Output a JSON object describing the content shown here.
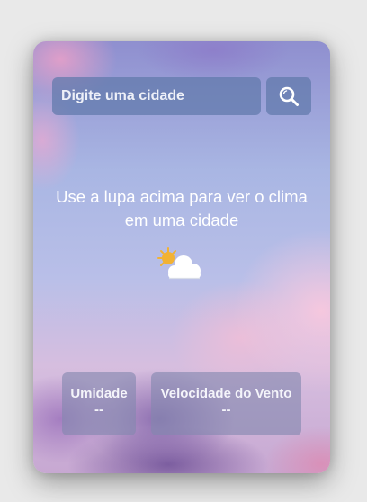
{
  "search": {
    "placeholder": "Digite uma cidade",
    "value": "",
    "button_icon": "search-icon"
  },
  "main": {
    "message": "Use a lupa acima para ver o clima em uma cidade",
    "weather_icon": "partly-cloudy-icon"
  },
  "stats": {
    "humidity": {
      "label": "Umidade",
      "value": "--"
    },
    "wind": {
      "label": "Velocidade do Vento",
      "value": "--"
    }
  },
  "colors": {
    "panel": "#5f78aa",
    "info_box": "#8287af",
    "text": "#ffffff",
    "sun": "#f2b233",
    "cloud": "#ffffff"
  }
}
